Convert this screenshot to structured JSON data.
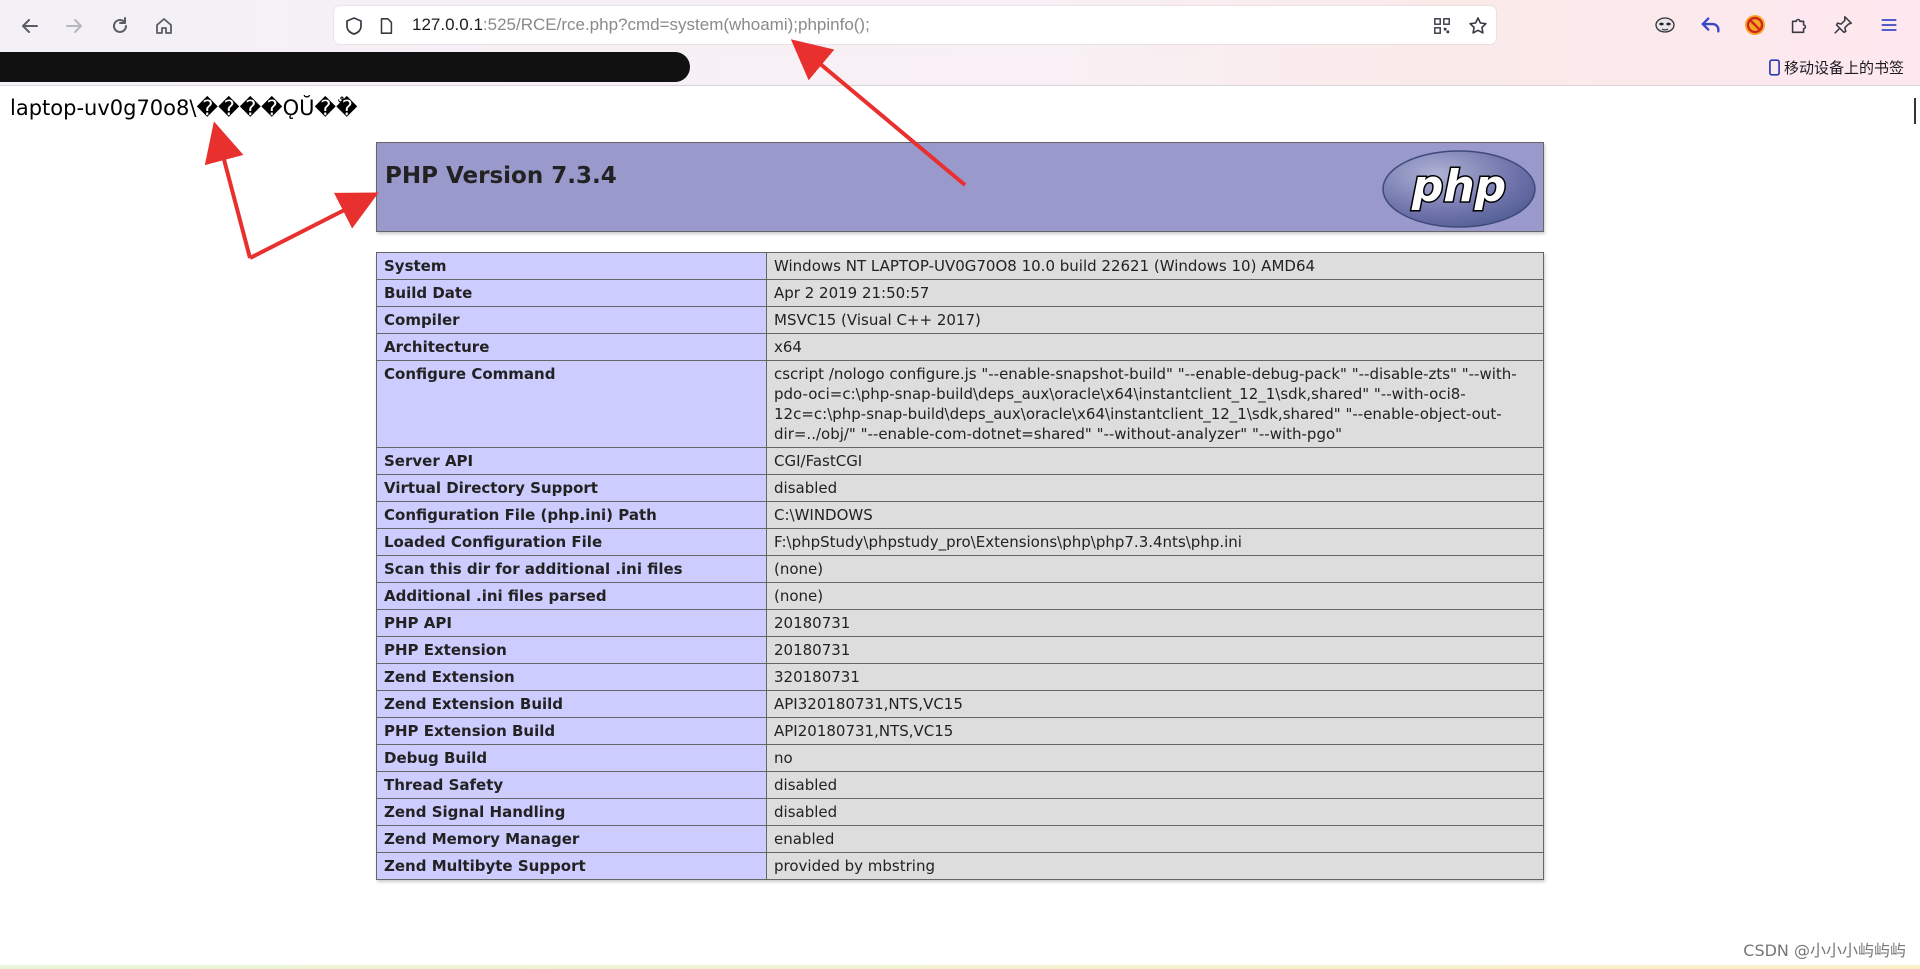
{
  "browser": {
    "url_host": "127.0.0.1",
    "url_rest": ":525/RCE/rce.php?cmd=system(whoami);phpinfo();",
    "bookmark_mobile": "移动设备上的书签"
  },
  "page": {
    "output": "laptop-uv0g70o8\\����ǪŬ��ٌ",
    "php_version_title": "PHP Version 7.3.4",
    "php_logo_text": "php"
  },
  "info_rows": [
    {
      "key": "System",
      "value": "Windows NT LAPTOP-UV0G70O8 10.0 build 22621 (Windows 10) AMD64"
    },
    {
      "key": "Build Date",
      "value": "Apr 2 2019 21:50:57"
    },
    {
      "key": "Compiler",
      "value": "MSVC15 (Visual C++ 2017)"
    },
    {
      "key": "Architecture",
      "value": "x64"
    },
    {
      "key": "Configure Command",
      "value": "cscript /nologo configure.js \"--enable-snapshot-build\" \"--enable-debug-pack\" \"--disable-zts\" \"--with-pdo-oci=c:\\php-snap-build\\deps_aux\\oracle\\x64\\instantclient_12_1\\sdk,shared\" \"--with-oci8-12c=c:\\php-snap-build\\deps_aux\\oracle\\x64\\instantclient_12_1\\sdk,shared\" \"--enable-object-out-dir=../obj/\" \"--enable-com-dotnet=shared\" \"--without-analyzer\" \"--with-pgo\""
    },
    {
      "key": "Server API",
      "value": "CGI/FastCGI"
    },
    {
      "key": "Virtual Directory Support",
      "value": "disabled"
    },
    {
      "key": "Configuration File (php.ini) Path",
      "value": "C:\\WINDOWS"
    },
    {
      "key": "Loaded Configuration File",
      "value": "F:\\phpStudy\\phpstudy_pro\\Extensions\\php\\php7.3.4nts\\php.ini"
    },
    {
      "key": "Scan this dir for additional .ini files",
      "value": "(none)"
    },
    {
      "key": "Additional .ini files parsed",
      "value": "(none)"
    },
    {
      "key": "PHP API",
      "value": "20180731"
    },
    {
      "key": "PHP Extension",
      "value": "20180731"
    },
    {
      "key": "Zend Extension",
      "value": "320180731"
    },
    {
      "key": "Zend Extension Build",
      "value": "API320180731,NTS,VC15"
    },
    {
      "key": "PHP Extension Build",
      "value": "API20180731,NTS,VC15"
    },
    {
      "key": "Debug Build",
      "value": "no"
    },
    {
      "key": "Thread Safety",
      "value": "disabled"
    },
    {
      "key": "Zend Signal Handling",
      "value": "disabled"
    },
    {
      "key": "Zend Memory Manager",
      "value": "enabled"
    },
    {
      "key": "Zend Multibyte Support",
      "value": "provided by mbstring"
    }
  ],
  "watermark": "CSDN @小小小屿屿屿",
  "icons": {
    "back": "arrow-left-icon",
    "forward": "arrow-right-icon",
    "reload": "reload-icon",
    "home": "home-icon",
    "shield": "shield-icon",
    "page": "page-icon",
    "qr": "qr-code-icon",
    "star": "star-icon",
    "mask": "mask-icon",
    "undo": "undo-icon",
    "blocked": "blocked-icon",
    "extensions": "puzzle-icon",
    "pin": "pin-icon",
    "menu": "menu-icon",
    "mobile": "mobile-icon"
  },
  "colors": {
    "header_bg": "#9999cc",
    "key_bg": "#ccccff",
    "value_bg": "#dddddd",
    "arrow": "#e8302e"
  }
}
